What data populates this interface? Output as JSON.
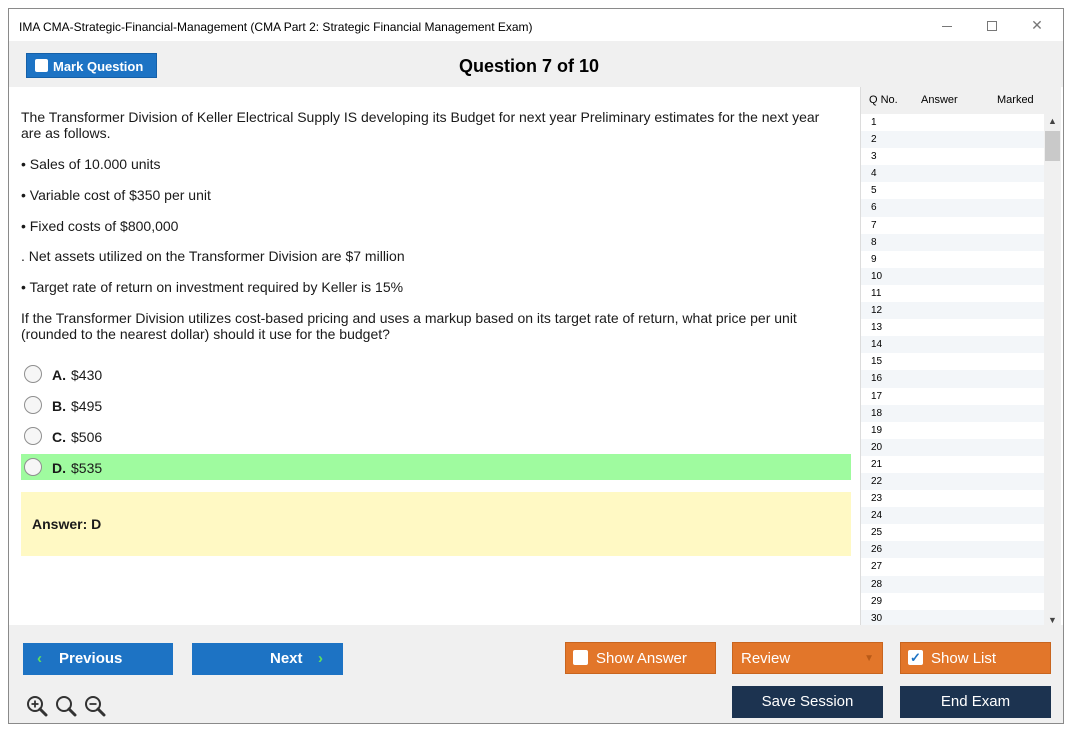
{
  "window": {
    "title": "IMA CMA-Strategic-Financial-Management (CMA Part 2: Strategic Financial Management Exam)",
    "controls": {
      "minimize": "—",
      "maximize": "☐",
      "close": "✕"
    }
  },
  "header": {
    "mark_label": "Mark Question",
    "question_title": "Question 7 of 10"
  },
  "question": {
    "intro": "The Transformer Division of Keller Electrical Supply IS developing its Budget for next year Preliminary estimates for the next year are as follows.",
    "bullets": [
      "• Sales of 10.000 units",
      "• Variable cost of $350 per unit",
      "• Fixed costs of $800,000",
      ". Net assets utilized on the Transformer Division are $7 million",
      "• Target rate of return on investment required by Keller is 15%"
    ],
    "prompt": "If the Transformer Division utilizes cost-based pricing and uses a markup based on its target rate of return, what price per unit (rounded to the nearest dollar) should it use for the budget?",
    "options": [
      {
        "letter": "A.",
        "text": "$430"
      },
      {
        "letter": "B.",
        "text": "$495"
      },
      {
        "letter": "C.",
        "text": "$506"
      },
      {
        "letter": "D.",
        "text": "$535"
      }
    ],
    "answer_text": "Answer: D"
  },
  "question_list": {
    "headers": {
      "qno": "Q No.",
      "answer": "Answer",
      "marked": "Marked"
    },
    "rows": [
      "1",
      "2",
      "3",
      "4",
      "5",
      "6",
      "7",
      "8",
      "9",
      "10",
      "11",
      "12",
      "13",
      "14",
      "15",
      "16",
      "17",
      "18",
      "19",
      "20",
      "21",
      "22",
      "23",
      "24",
      "25",
      "26",
      "27",
      "28",
      "29",
      "30"
    ]
  },
  "footer": {
    "previous": "Previous",
    "next": "Next",
    "show_answer": "Show Answer",
    "review": "Review",
    "show_list": "Show List",
    "save_session": "Save Session",
    "end_exam": "End Exam"
  },
  "colors": {
    "accent_blue": "#1d73c4",
    "orange": "#e2762a",
    "dark_navy": "#1c3350",
    "correct_green": "#9ffb9f",
    "answer_yellow": "#fff9c4"
  }
}
